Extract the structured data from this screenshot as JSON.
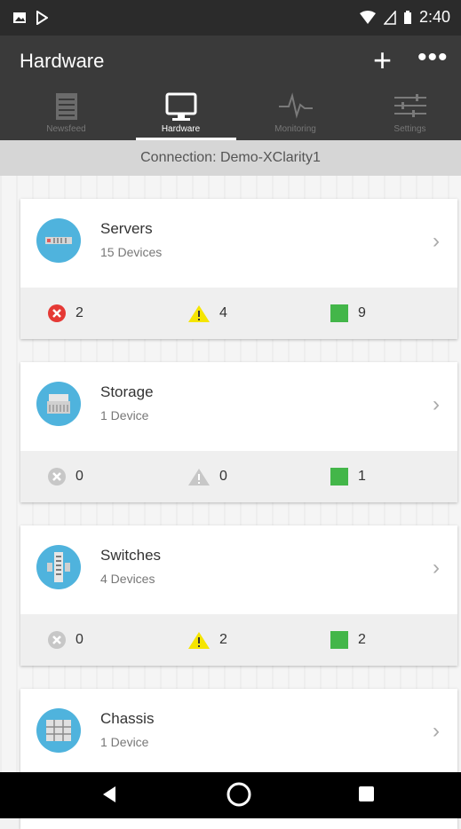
{
  "status_bar": {
    "time": "2:40"
  },
  "app_bar": {
    "title": "Hardware",
    "add_label": "+",
    "more_label": "•••"
  },
  "tabs": [
    {
      "label": "Newsfeed",
      "icon": "newsfeed-icon"
    },
    {
      "label": "Hardware",
      "icon": "monitor-icon"
    },
    {
      "label": "Monitoring",
      "icon": "pulse-icon"
    },
    {
      "label": "Settings",
      "icon": "sliders-icon"
    }
  ],
  "connection": {
    "label": "Connection: Demo-XClarity1"
  },
  "cards": [
    {
      "name": "Servers",
      "count": "15 Devices",
      "icon": "server-icon",
      "critical": "2",
      "warning": "4",
      "normal": "9"
    },
    {
      "name": "Storage",
      "count": "1 Device",
      "icon": "storage-icon",
      "critical": "0",
      "warning": "0",
      "normal": "1"
    },
    {
      "name": "Switches",
      "count": "4 Devices",
      "icon": "switch-icon",
      "critical": "0",
      "warning": "2",
      "normal": "2"
    },
    {
      "name": "Chassis",
      "count": "1 Device",
      "icon": "chassis-icon"
    }
  ],
  "colors": {
    "critical": "#e53935",
    "warning": "#f5e500",
    "normal": "#43b649",
    "muted": "#c7c7c7",
    "icon_bg": "#4fb3dd"
  }
}
